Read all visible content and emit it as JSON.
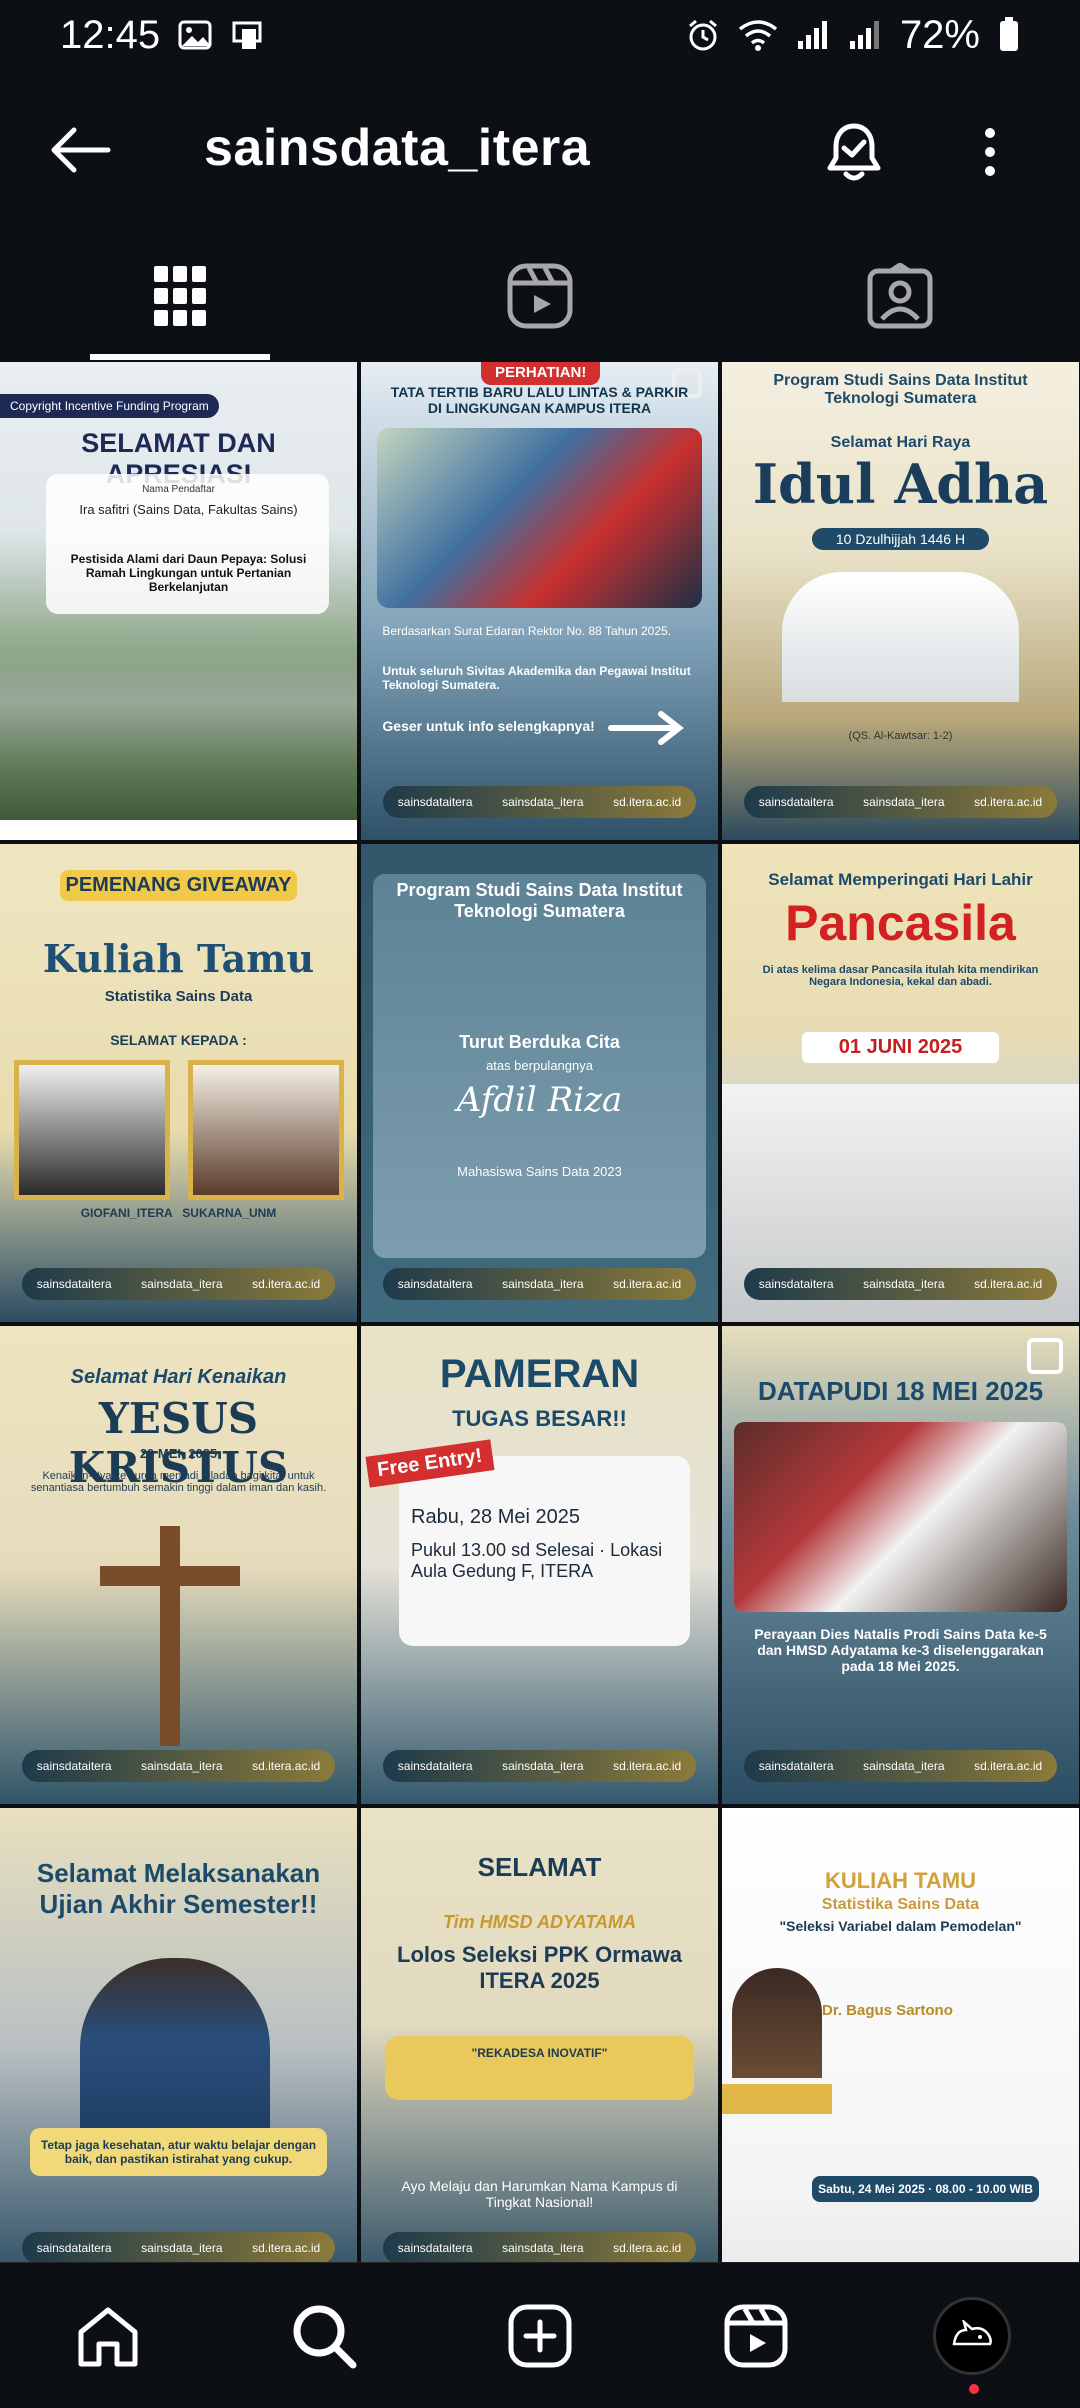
{
  "status": {
    "time": "12:45",
    "battery": "72%"
  },
  "header": {
    "username": "sainsdata_itera"
  },
  "posts": [
    {
      "title": "SELAMAT DAN APRESIASI",
      "badge": "Copyright Incentive Funding Program",
      "line1": "Nama Pendaftar",
      "line2": "Ira safitri (Sains Data, Fakultas Sains)",
      "line3": "Pestisida Alami dari Daun Pepaya: Solusi Ramah Lingkungan untuk Pertanian Berkelanjutan"
    },
    {
      "title": "TATA TERTIB BARU LALU LINTAS & PARKIR DI LINGKUNGAN KAMPUS ITERA",
      "badge": "PERHATIAN!",
      "line1": "Berdasarkan Surat Edaran Rektor No. 88 Tahun 2025.",
      "line2": "Untuk seluruh Sivitas Akademika dan Pegawai Institut Teknologi Sumatera.",
      "line3": "Geser untuk info selengkapnya!"
    },
    {
      "title": "Idul Adha",
      "badge": "Program Studi Sains Data Institut Teknologi Sumatera",
      "line1": "Selamat Hari Raya",
      "line2": "10 Dzulhijjah 1446 H",
      "line3": "(QS. Al-Kawtsar: 1-2)"
    },
    {
      "title": "Kuliah Tamu",
      "badge": "PEMENANG GIVEAWAY",
      "line1": "Statistika Sains Data",
      "line2": "SELAMAT KEPADA :",
      "line3": "GIOFANI_ITERA   SUKARNA_UNM"
    },
    {
      "title": "Turut Berduka Cita",
      "badge": "Program Studi Sains Data Institut Teknologi Sumatera",
      "line1": "atas berpulangnya",
      "line2": "Afdil Riza",
      "line3": "Mahasiswa Sains Data 2023"
    },
    {
      "title": "Pancasila",
      "badge": "Selamat Memperingati Hari Lahir",
      "line1": "Di atas kelima dasar Pancasila itulah kita mendirikan Negara Indonesia, kekal dan abadi.",
      "line2": "01 JUNI 2025",
      "line3": ""
    },
    {
      "title": "YESUS KRISTUS",
      "badge": "Selamat Hari Kenaikan",
      "line1": "29 MEI, 2025",
      "line2": "Kenaikan-Nya ke surga menjadi teladan bagi kita, untuk senantiasa bertumbuh semakin tinggi dalam iman dan kasih.",
      "line3": ""
    },
    {
      "title": "PAMERAN",
      "badge": "TUGAS BESAR!!",
      "line1": "Free Entry!",
      "line2": "Rabu, 28 Mei 2025",
      "line3": "Pukul 13.00 sd Selesai · Lokasi Aula Gedung F, ITERA"
    },
    {
      "title": "DATAPUDI 18 MEI 2025",
      "badge": "",
      "line1": "Perayaan Dies Natalis Prodi Sains Data ke-5 dan HMSD Adyatama ke-3 diselenggarakan pada 18 Mei 2025.",
      "line2": "",
      "line3": ""
    },
    {
      "title": "Selamat Melaksanakan Ujian Akhir Semester!!",
      "badge": "",
      "line1": "Tetap jaga kesehatan, atur waktu belajar dengan baik, dan pastikan istirahat yang cukup.",
      "line2": "",
      "line3": ""
    },
    {
      "title": "Lolos Seleksi PPK Ormawa ITERA 2025",
      "badge": "SELAMAT",
      "line1": "Tim HMSD ADYATAMA",
      "line2": "\"REKADESA INOVATIF\"",
      "line3": "Ayo Melaju dan Harumkan Nama Kampus di Tingkat Nasional!"
    },
    {
      "title": "KULIAH TAMU",
      "badge": "Statistika Sains Data",
      "line1": "\"Seleksi Variabel dalam Pemodelan\"",
      "line2": "Dr. Bagus Sartono",
      "line3": "Sabtu, 24 Mei 2025 · 08.00 - 10.00 WIB"
    }
  ],
  "footer_pill": {
    "a": "sainsdataitera",
    "b": "sainsdata_itera",
    "c": "sd.itera.ac.id"
  }
}
